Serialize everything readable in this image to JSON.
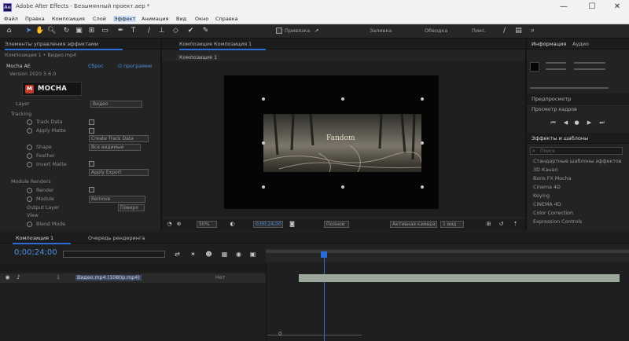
{
  "window": {
    "title": "Adobe After Effects - Безымянный проект.aep *",
    "app_icon": "Ae",
    "minimize": "—",
    "maximize": "☐",
    "close": "✕"
  },
  "menu": [
    "Файл",
    "Правка",
    "Композиция",
    "Слой",
    "Эффект",
    "Анимация",
    "Вид",
    "Окно",
    "Справка"
  ],
  "toolbar": {
    "snapping_label": "Привязка",
    "fill_label": "Заливка",
    "stroke_label": "Обводка",
    "px_label": "Пикс."
  },
  "effect_controls": {
    "tab_label": "Элементы управления эффектами",
    "header_left": "Композиция 1 • Видео.mp4",
    "effect_name": "Mocha AE",
    "reset_label": "Сброс",
    "about_label": "О программе",
    "version_label": "Version 2020 5.6.0",
    "mocha_button": "MOCHA",
    "rows": [
      {
        "label": "Layer",
        "value": "Видео"
      },
      {
        "label": "Tracking"
      },
      {
        "label": "Track Data"
      },
      {
        "label": "Apply Matte"
      },
      {
        "label": "Shape",
        "value": "Все видимые"
      },
      {
        "label": "Feather"
      },
      {
        "label": "Invert Matte"
      },
      {
        "label": "Module Renders"
      },
      {
        "label": "Render"
      },
      {
        "label": "Module",
        "value": "Remove"
      },
      {
        "label": "Output Layer"
      },
      {
        "label": "View"
      },
      {
        "label": "Blend Mode"
      }
    ],
    "field_create_track": "Create Track Data",
    "field_apply_export": "Apply Export",
    "field_view": "Поверх"
  },
  "composition": {
    "tab_label": "Композиция Композиция 1",
    "subtab_label": "Композиция 1",
    "footage_caption": "Fandom",
    "zoom": "50%",
    "timecode": "0;00;24;00",
    "quality": "Полное",
    "camera": "Активная камера",
    "views": "1 вид"
  },
  "info_panel": {
    "tab_info": "Информация",
    "tab_audio": "Аудио",
    "tab_preview": "Предпросмотр",
    "preview_label": "Просмотр кадров",
    "effects_tab": "Эффекты и шаблоны",
    "search_placeholder": "Поиск",
    "effect_list": [
      "Стандартные шаблоны эффектов",
      "3D Канал",
      "Boris FX Mocha",
      "Cinema 4D",
      "Keying",
      "CINEMA 4D",
      "Color Correction",
      "Expression Controls"
    ]
  },
  "timeline": {
    "tab_label": "Композиция 1",
    "render_queue": "Очередь рендеринга",
    "timecode": "0;00;24;00",
    "layer_name": "Видео.mp4 (1080р.mp4)",
    "layer_number": "1",
    "parent_value": "Нет",
    "zoom_value": "0"
  },
  "colors": {
    "accent_blue": "#2b6cd6",
    "timecode_blue": "#4a8fe0",
    "track_bar": "#9aa79a"
  }
}
